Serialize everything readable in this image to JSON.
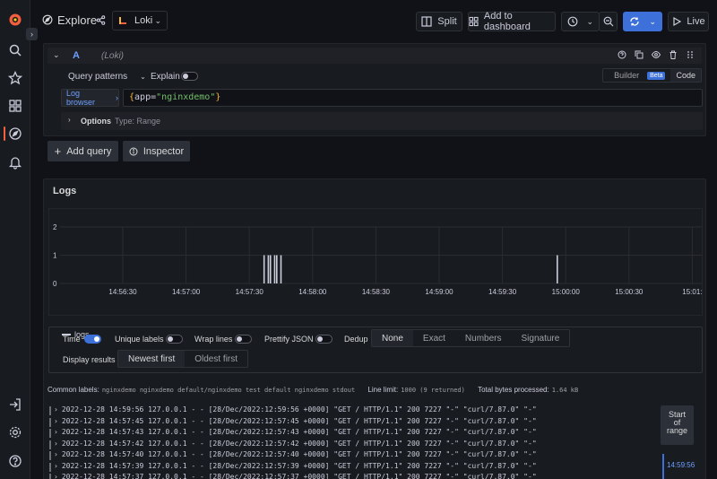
{
  "app": {
    "title": "Explore",
    "datasource": "Loki"
  },
  "toolbar": {
    "split_label": "Split",
    "add_dashboard_label": "Add to dashboard",
    "live_label": "Live"
  },
  "query": {
    "ref_id": "A",
    "datasource_label": "(Loki)",
    "patterns_label": "Query patterns",
    "explain_label": "Explain",
    "explain_enabled": false,
    "builder_label": "Builder",
    "beta_label": "Beta",
    "code_label": "Code",
    "log_browser_label": "Log browser",
    "expr_open": "{",
    "expr_key": "app=",
    "expr_value": "\"nginxdemo\"",
    "expr_close": "}",
    "options_label": "Options",
    "options_type": "Type: Range"
  },
  "actions": {
    "add_query_label": "Add query",
    "inspector_label": "Inspector"
  },
  "logs": {
    "title": "Logs",
    "legend": "logs",
    "time_label": "Time",
    "unique_labels_label": "Unique labels",
    "wrap_lines_label": "Wrap lines",
    "prettify_label": "Prettify JSON",
    "dedup_label": "Dedup",
    "dedup_options": [
      "None",
      "Exact",
      "Numbers",
      "Signature"
    ],
    "dedup_selected": "None",
    "display_results_label": "Display results",
    "order_options": [
      "Newest first",
      "Oldest first"
    ],
    "order_selected": "Newest first",
    "common_labels_label": "Common labels:",
    "common_labels_values": "nginxdemo nginxdemo default/nginxdemo test default nginxdemo stdout",
    "line_limit_label": "Line limit:",
    "line_limit_value": "1000 (9 returned)",
    "total_bytes_label": "Total bytes processed:",
    "total_bytes_value": "1.64 kB",
    "start_of_range_line1": "Start",
    "start_of_range_line2": "of",
    "start_of_range_line3": "range",
    "range_marker_time": "14:59:56",
    "lines": [
      "2022-12-28 14:59:56 127.0.0.1 - - [28/Dec/2022:12:59:56 +0000] \"GET / HTTP/1.1\" 200 7227 \"-\" \"curl/7.87.0\" \"-\"",
      "2022-12-28 14:57:45 127.0.0.1 - - [28/Dec/2022:12:57:45 +0000] \"GET / HTTP/1.1\" 200 7227 \"-\" \"curl/7.87.0\" \"-\"",
      "2022-12-28 14:57:43 127.0.0.1 - - [28/Dec/2022:12:57:43 +0000] \"GET / HTTP/1.1\" 200 7227 \"-\" \"curl/7.87.0\" \"-\"",
      "2022-12-28 14:57:42 127.0.0.1 - - [28/Dec/2022:12:57:42 +0000] \"GET / HTTP/1.1\" 200 7227 \"-\" \"curl/7.87.0\" \"-\"",
      "2022-12-28 14:57:40 127.0.0.1 - - [28/Dec/2022:12:57:40 +0000] \"GET / HTTP/1.1\" 200 7227 \"-\" \"curl/7.87.0\" \"-\"",
      "2022-12-28 14:57:39 127.0.0.1 - - [28/Dec/2022:12:57:39 +0000] \"GET / HTTP/1.1\" 200 7227 \"-\" \"curl/7.87.0\" \"-\"",
      "2022-12-28 14:57:37 127.0.0.1 - - [28/Dec/2022:12:57:37 +0000] \"GET / HTTP/1.1\" 200 7227 \"-\" \"curl/7.87.0\" \"-\""
    ]
  },
  "chart_data": {
    "type": "bar",
    "y_ticks": [
      "0",
      "1",
      "2"
    ],
    "ylim": [
      0,
      2
    ],
    "x_ticks": [
      "14:56:30",
      "14:57:00",
      "14:57:30",
      "14:58:00",
      "14:58:30",
      "14:59:00",
      "14:59:30",
      "15:00:00",
      "15:00:30",
      "15:01:"
    ],
    "series": [
      {
        "name": "logs",
        "points": [
          {
            "t": "14:57:37",
            "count": 1
          },
          {
            "t": "14:57:39",
            "count": 1
          },
          {
            "t": "14:57:40",
            "count": 1
          },
          {
            "t": "14:57:42",
            "count": 1
          },
          {
            "t": "14:57:43",
            "count": 1
          },
          {
            "t": "14:57:45",
            "count": 1
          },
          {
            "t": "14:59:56",
            "count": 1
          }
        ]
      }
    ]
  },
  "colors": {
    "background": "#111217",
    "panel": "#181b1f",
    "primary": "#3d71d9",
    "link": "#6e9fff",
    "grafana_orange": "#f55f3e"
  }
}
